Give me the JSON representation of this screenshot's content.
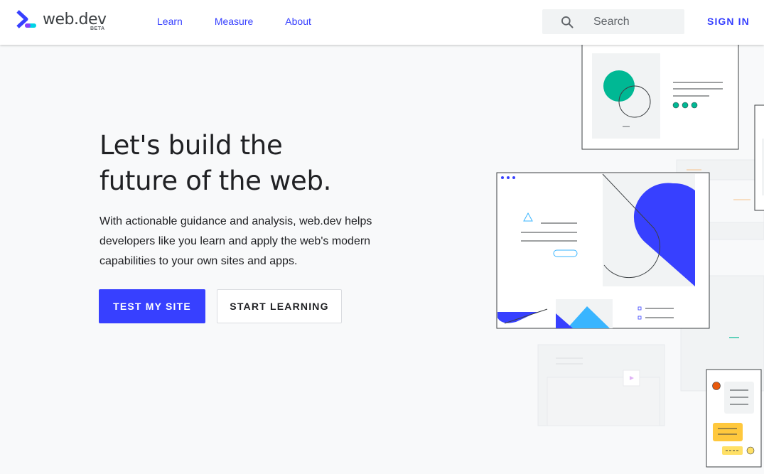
{
  "header": {
    "logo_text": "web.dev",
    "logo_badge": "BETA",
    "nav": [
      {
        "label": "Learn"
      },
      {
        "label": "Measure"
      },
      {
        "label": "About"
      }
    ],
    "search_placeholder": "Search",
    "signin_label": "SIGN IN"
  },
  "hero": {
    "title_line1": "Let's build the",
    "title_line2": "future of the web.",
    "description": "With actionable guidance and analysis, web.dev helps developers like you learn and apply the web's modern capabilities to your own sites and apps.",
    "primary_button": "TEST MY SITE",
    "secondary_button": "START LEARNING"
  },
  "colors": {
    "accent": "#3740ff",
    "teal": "#00b894",
    "sky": "#39b5ff",
    "orange": "#e8590c",
    "yellow": "#ffc83d"
  }
}
